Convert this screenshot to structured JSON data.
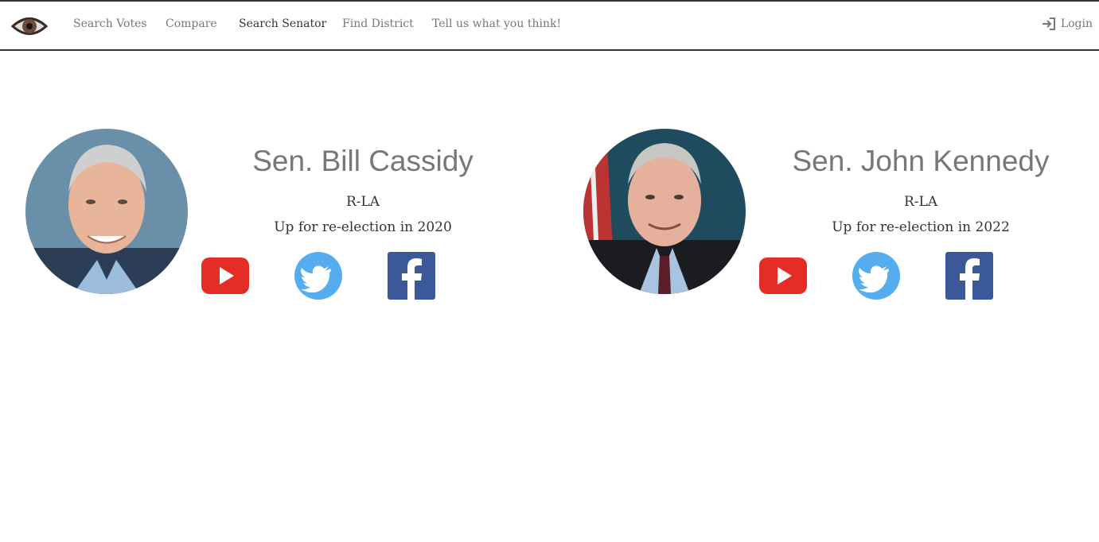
{
  "nav": {
    "logo_icon": "eye-logo-icon",
    "items": [
      {
        "label": "Search Votes",
        "active": false
      },
      {
        "label": "Compare",
        "active": false
      },
      {
        "label": "Search Senator",
        "active": true
      },
      {
        "label": "Find District",
        "active": false
      },
      {
        "label": "Tell us what you think!",
        "active": false
      }
    ],
    "login_label": "Login",
    "login_icon": "sign-in-icon"
  },
  "senators": [
    {
      "name": "Sen. Bill Cassidy",
      "party_state": "R-LA",
      "reelection": "Up for re-election in 2020",
      "social": [
        "youtube-icon",
        "twitter-icon",
        "facebook-icon"
      ]
    },
    {
      "name": "Sen. John Kennedy",
      "party_state": "R-LA",
      "reelection": "Up for re-election in 2022",
      "social": [
        "youtube-icon",
        "twitter-icon",
        "facebook-icon"
      ]
    }
  ],
  "colors": {
    "youtube": "#e52d27",
    "twitter": "#55acee",
    "facebook": "#3b5998",
    "nav_border": "#333333",
    "nav_text": "#777777"
  }
}
